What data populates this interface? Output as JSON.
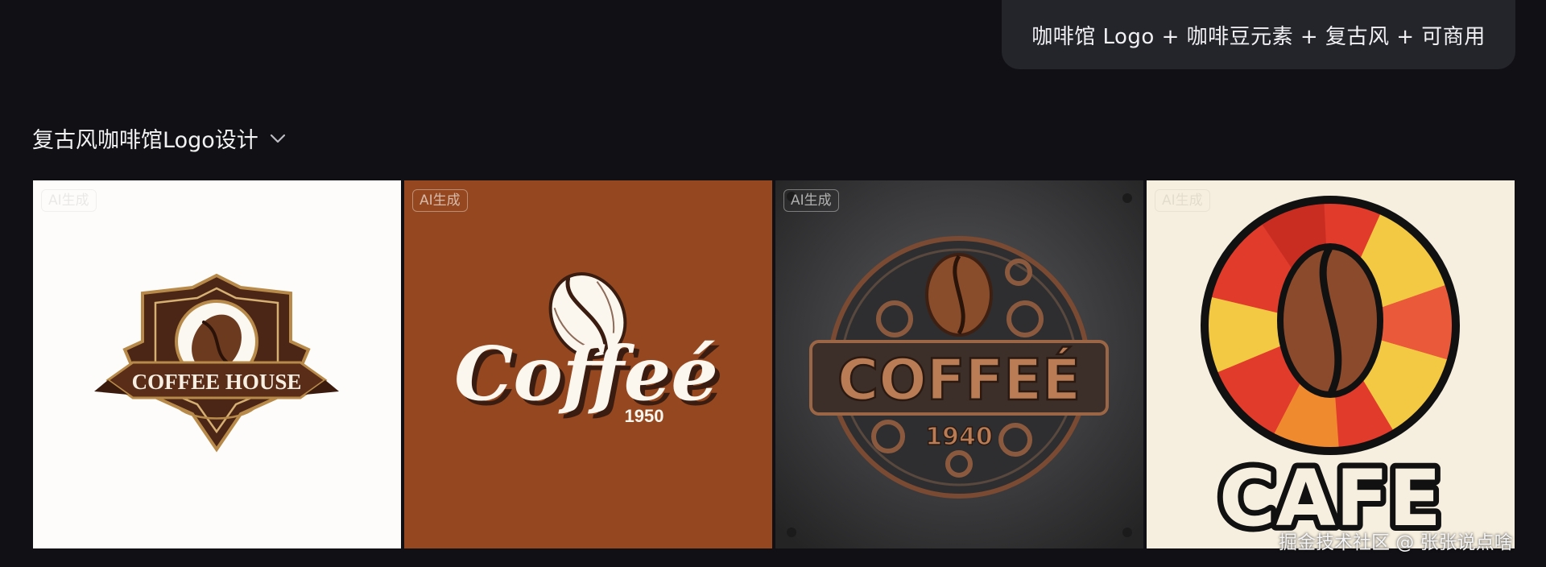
{
  "prompt": {
    "text": "咖啡馆 Logo + 咖啡豆元素 + 复古风 + 可商用"
  },
  "gallery": {
    "title": "复古风咖啡馆Logo设计",
    "images": [
      {
        "badge": "AI生成",
        "logo_text": "COFFEE HOUSE",
        "year": ""
      },
      {
        "badge": "AI生成",
        "logo_text": "Coffeé",
        "year": "1950"
      },
      {
        "badge": "AI生成",
        "logo_text": "COFFEÉ",
        "year": "1940"
      },
      {
        "badge": "AI生成",
        "logo_text": "CAFE",
        "year": ""
      }
    ]
  },
  "watermark": "掘金技术社区 @ 张张说点啥",
  "colors": {
    "background": "#111115",
    "bubble": "#24252b"
  }
}
